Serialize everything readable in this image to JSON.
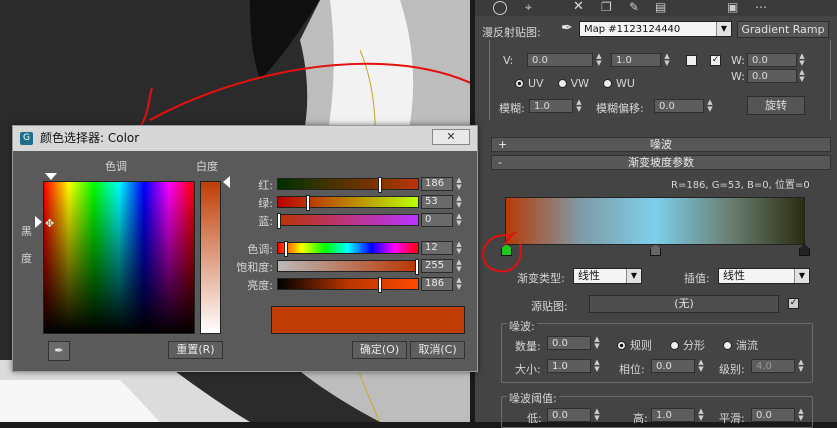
{
  "toolbar_icons": [
    "sphere-icon",
    "pin-icon",
    "cross-icon",
    "copy-icon",
    "paint-icon",
    "chart-icon",
    "box-icon",
    "dots-icon"
  ],
  "map_row": {
    "label": "漫反射贴图:",
    "map_name": "Map #1123124440",
    "type_button": "Gradient Ramp"
  },
  "coords": {
    "v_label": "V:",
    "v_value": "0.0",
    "v2_value": "1.0",
    "w_label": "W:",
    "w_value": "0.0",
    "w2_value": "0.0",
    "uv": "UV",
    "vw": "VW",
    "wu": "WU",
    "blur_label": "模糊:",
    "blur_value": "1.0",
    "blur_offset_label": "模糊偏移:",
    "blur_offset_value": "0.0",
    "rotate_button": "旋转"
  },
  "noise_rollout": {
    "sign": "+",
    "title": "噪波"
  },
  "gradient_rollout": {
    "sign": "-",
    "title": "渐变坡度参数"
  },
  "gradient": {
    "readout": "R=186, G=53, B=0, 位置=0",
    "colors": [
      "#b83a08",
      "#7f9aa6",
      "#7dd0ec",
      "#6a7f72",
      "#2c2d12"
    ],
    "markers": [
      0,
      0.5,
      1
    ]
  },
  "gradient_type": {
    "label": "渐变类型:",
    "value": "线性"
  },
  "interp": {
    "label": "插值:",
    "value": "线性"
  },
  "source_map": {
    "label": "源贴图:",
    "value": "(无)"
  },
  "noise_group": {
    "title": "噪波:",
    "amount_label": "数量:",
    "amount_value": "0.0",
    "regular": "规则",
    "fractal": "分形",
    "turbulence": "湍流",
    "size_label": "大小:",
    "size_value": "1.0",
    "phase_label": "相位:",
    "phase_value": "0.0",
    "levels_label": "级别:",
    "levels_value": "4.0"
  },
  "noise_threshold": {
    "title": "噪波阈值:",
    "low_label": "低:",
    "low_value": "0.0",
    "high_label": "高:",
    "high_value": "1.0",
    "smooth_label": "平滑:",
    "smooth_value": "0.0"
  },
  "dialog": {
    "title": "颜色选择器: Color",
    "hue_label": "色调",
    "white_label": "白度",
    "black_label": "黑",
    "degree_label": "度",
    "current_color": "#c03e05",
    "sliders": [
      {
        "label": "红:",
        "value": "186",
        "pos": 0.73,
        "gradient": "linear-gradient(90deg,#003000,#b83500)"
      },
      {
        "label": "绿:",
        "value": "53",
        "pos": 0.21,
        "gradient": "linear-gradient(90deg,#ba0000,#baff00)"
      },
      {
        "label": "蓝:",
        "value": "0",
        "pos": 0.0,
        "gradient": "linear-gradient(90deg,#ba3500,#ba35ff)"
      },
      {
        "label": "色调:",
        "value": "12",
        "pos": 0.05,
        "gradient": "linear-gradient(90deg,#f00,#ff0,#0f0,#0ff,#00f,#f0f,#f00)"
      },
      {
        "label": "饱和度:",
        "value": "255",
        "pos": 1.0,
        "gradient": "linear-gradient(90deg,#bababa,#ba3500)"
      },
      {
        "label": "亮度:",
        "value": "186",
        "pos": 0.73,
        "gradient": "linear-gradient(90deg,#000,#ba3500,#ff4a00)"
      }
    ],
    "reset_button": "重置(R)",
    "ok_button": "确定(O)",
    "cancel_button": "取消(C)"
  }
}
